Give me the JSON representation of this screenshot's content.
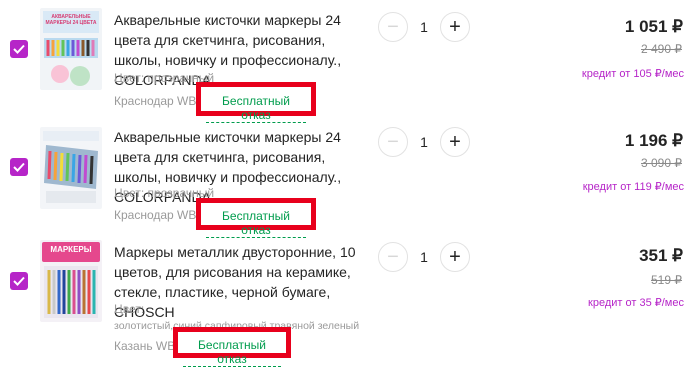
{
  "cart": {
    "items": [
      {
        "title": "Акварельные кисточки маркеры 24 цвета для скетчинга, рисования, школы, новичку и профессионалу., COLORPANDA",
        "color_label": "Цвет: прозрачный",
        "warehouse": "Краснодар WB",
        "free_return": "Бесплатный отказ",
        "quantity": "1",
        "price": "1 051 ₽",
        "old_price": "2 490 ₽",
        "credit": "кредит от 105 ₽/мес",
        "thumb_caption": "АКВАРЕЛЬНЫЕ МАРКЕРЫ 24 ЦВЕТА"
      },
      {
        "title": "Акварельные кисточки маркеры 24 цвета для скетчинга, рисования, школы, новичку и профессионалу., COLORPANDA",
        "color_label": "Цвет: прозрачный",
        "warehouse": "Краснодар WB",
        "free_return": "Бесплатный отказ",
        "quantity": "1",
        "price": "1 196 ₽",
        "old_price": "3 090 ₽",
        "credit": "кредит от 119 ₽/мес",
        "thumb_caption": ""
      },
      {
        "title": "Маркеры металлик двусторонние, 10 цветов, для рисования на керамике, стекле, пластике, черной бумаге, CHOSCH",
        "color_label": "Цвет:",
        "color_value": "золотистый,синий,сапфировый,травяной зеленый",
        "warehouse": "Казань WB",
        "free_return": "Бесплатный отказ",
        "quantity": "1",
        "price": "351 ₽",
        "old_price": "519 ₽",
        "credit": "кредит от 35 ₽/мес",
        "thumb_caption": "МАРКЕРЫ"
      }
    ],
    "minus_symbol": "−",
    "plus_symbol": "+",
    "accent_color": "#b625c8",
    "highlight_color": "#e8001c",
    "free_return_color": "#009c4d"
  }
}
